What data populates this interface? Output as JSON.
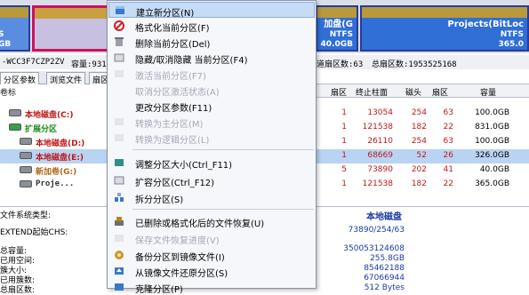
{
  "disk_map": {
    "seg_a": {
      "line2": "S",
      "line3": "GB"
    },
    "seg_c": {
      "title": "加盘(G",
      "fs": "NTFS",
      "size": "40.0GB"
    },
    "seg_d": {
      "title": "Projects(BitLoc",
      "fs": "NTFS",
      "size": "365.0"
    }
  },
  "info_strip": {
    "model": "-WCC3F7CZP2ZV",
    "capacity": "容量:931.",
    "sectors_per_track": "道扇区数:63",
    "total_sectors": "总扇区数:1953525168"
  },
  "left_panel": {
    "tabs": [
      "分区参数",
      "浏览文件",
      "扇区"
    ],
    "tree_header": "卷标",
    "items": [
      {
        "label": "本地磁盘(C:)",
        "color": "#c01818"
      },
      {
        "label": "扩展分区",
        "color": "#1a8a1a"
      },
      {
        "label": "本地磁盘(D:)",
        "color": "#c01818"
      },
      {
        "label": "本地磁盘(E:)",
        "color": "#c01818"
      },
      {
        "label": "新加卷(G:)",
        "color": "#b0681a"
      },
      {
        "label": "Proje...",
        "color": "#333333"
      }
    ]
  },
  "table": {
    "headers": [
      "扇区",
      "终止柱面",
      "磁头",
      "扇区",
      "容量"
    ],
    "rows": [
      [
        "1",
        "13054",
        "254",
        "63",
        "100.0GB"
      ],
      [
        "1",
        "121538",
        "182",
        "22",
        "831.0GB"
      ],
      [
        "1",
        "26110",
        "254",
        "63",
        "100.0GB"
      ],
      [
        "1",
        "68669",
        "52",
        "26",
        "326.0GB"
      ],
      [
        "5",
        "73890",
        "202",
        "41",
        "40.0GB"
      ],
      [
        "1",
        "121538",
        "182",
        "22",
        "365.0GB"
      ]
    ]
  },
  "details": {
    "fs_type_label": "文件系统类型:",
    "fs_type_value": "本地磁盘",
    "rows": [
      {
        "k": "EXTEND起始CHS:",
        "v": "73890/254/63"
      },
      {
        "k": "",
        "v": ""
      },
      {
        "k": "总容量:",
        "v": "350053124608"
      },
      {
        "k": "已用空间:",
        "v": "255.8GB"
      },
      {
        "k": "簇大小:",
        "v": "85462188"
      },
      {
        "k": "已用簇数:",
        "v": "67066944"
      },
      {
        "k": "总扇区数:",
        "v": "512 Bytes"
      }
    ]
  },
  "context_menu": {
    "items": [
      {
        "label": "建立新分区(N)",
        "disabled": false,
        "highlight": true,
        "icon": "new-partition-icon"
      },
      {
        "label": "格式化当前分区(F)",
        "disabled": false,
        "icon": "format-icon"
      },
      {
        "label": "删除当前分区(Del)",
        "disabled": false,
        "icon": "delete-icon"
      },
      {
        "label": "隐藏/取消隐藏 当前分区(F4)",
        "disabled": false,
        "icon": "hide-icon"
      },
      {
        "label": "激活当前分区(F7)",
        "disabled": true,
        "icon": "activate-icon"
      },
      {
        "label": "取消分区激活状态(A)",
        "disabled": true,
        "icon": "deactivate-icon"
      },
      {
        "label": "更改分区参数(F11)",
        "disabled": false,
        "icon": "params-icon"
      },
      {
        "label": "转换为主分区(M)",
        "disabled": true,
        "icon": "convert-primary-icon"
      },
      {
        "label": "转换为逻辑分区(L)",
        "disabled": true,
        "icon": "convert-logical-icon"
      },
      {
        "label": "调整分区大小(Ctrl_F11)",
        "disabled": false,
        "icon": "resize-icon"
      },
      {
        "label": "扩容分区(Ctrl_F12)",
        "disabled": false,
        "icon": "expand-icon"
      },
      {
        "label": "拆分分区(S)",
        "disabled": false,
        "icon": "split-icon"
      },
      {
        "label": "已删除或格式化后的文件恢复(U)",
        "disabled": false,
        "icon": "recover-icon"
      },
      {
        "label": "保存文件恢复进度(V)",
        "disabled": true,
        "icon": "save-progress-icon"
      },
      {
        "label": "备份分区到镜像文件(I)",
        "disabled": false,
        "icon": "backup-image-icon"
      },
      {
        "label": "从镜像文件还原分区(S)",
        "disabled": false,
        "icon": "restore-image-icon"
      },
      {
        "label": "克隆分区(P)",
        "disabled": false,
        "icon": "clone-icon"
      }
    ]
  }
}
